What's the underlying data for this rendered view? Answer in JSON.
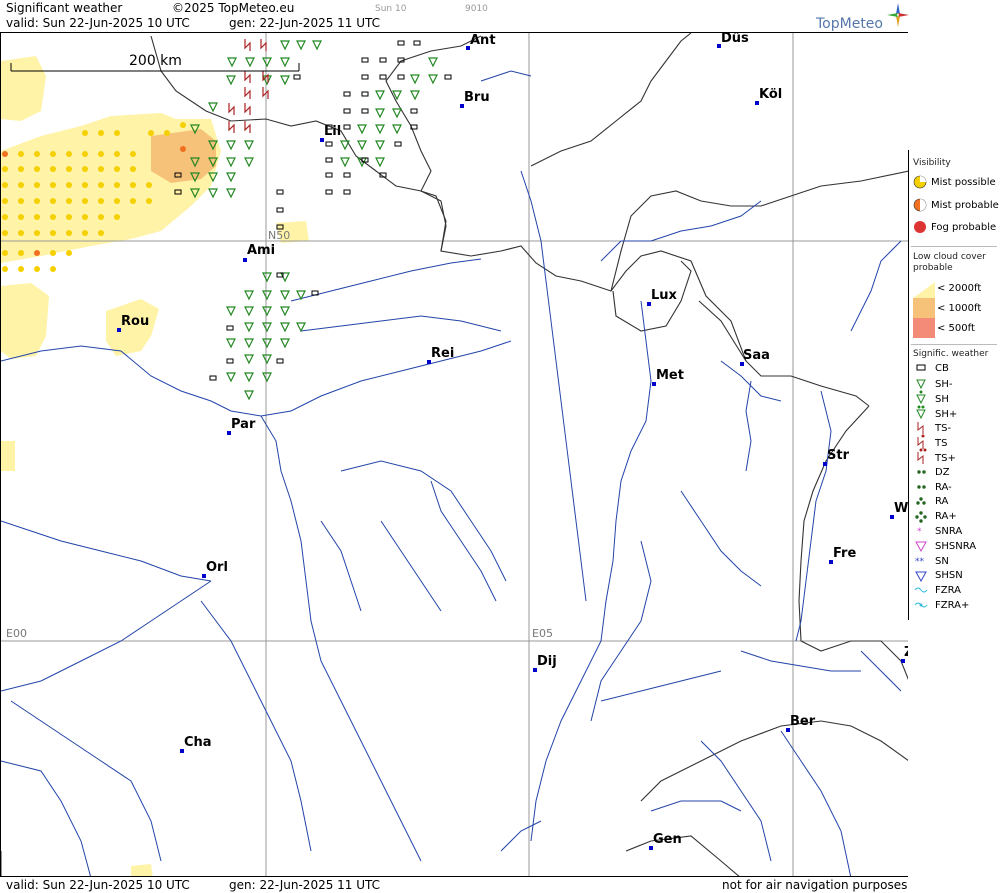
{
  "header": {
    "product": "Significant weather",
    "copyright": "©2025 TopMeteo.eu",
    "extra_small_1": "Sun 10",
    "extra_small_2": "9010",
    "valid": "valid:  Sun  22-Jun-2025  10 UTC",
    "generated": "gen: 22-Jun-2025 11 UTC",
    "logo": "TopMeteo"
  },
  "footer": {
    "valid": "valid:  Sun  22-Jun-2025  10 UTC",
    "generated": "gen: 22-Jun-2025 11 UTC",
    "disclaimer": "not for air navigation purposes"
  },
  "map": {
    "scale_label": "200 km",
    "grid_labels": {
      "n50": "N50",
      "e00": "E00",
      "e05": "E05"
    },
    "cities": [
      {
        "name": "Ant"
      },
      {
        "name": "Düs"
      },
      {
        "name": "Köl"
      },
      {
        "name": "Bru"
      },
      {
        "name": "Lil"
      },
      {
        "name": "Ami"
      },
      {
        "name": "Lux"
      },
      {
        "name": "Rou"
      },
      {
        "name": "Rei"
      },
      {
        "name": "Saa"
      },
      {
        "name": "Met"
      },
      {
        "name": "Par"
      },
      {
        "name": "Str"
      },
      {
        "name": "W"
      },
      {
        "name": "Fre"
      },
      {
        "name": "Orl"
      },
      {
        "name": "Dij"
      },
      {
        "name": "Z"
      },
      {
        "name": "Ber"
      },
      {
        "name": "Cha"
      },
      {
        "name": "Gen"
      }
    ],
    "colors": {
      "city_dot": "#0000cc",
      "river": "#2244aa",
      "border": "#333333",
      "grid": "#999999",
      "cloud_2000": "#fff3a8",
      "cloud_1000": "#f6c27a",
      "mist_possible": "#f5d000",
      "mist_probable": "#f07020",
      "shower_green": "#228822",
      "thunderstorm_red": "#aa2222"
    }
  },
  "legend": {
    "visibility": {
      "title": "Visibility",
      "items": [
        {
          "label": "Mist possible"
        },
        {
          "label": "Mist probable"
        },
        {
          "label": "Fog probable"
        }
      ]
    },
    "low_cloud": {
      "title_1": "Low cloud cover",
      "title_2": "probable",
      "items": [
        {
          "label": "< 2000ft"
        },
        {
          "label": "< 1000ft"
        },
        {
          "label": "<   500ft"
        }
      ]
    },
    "sigwx": {
      "title": "Signific. weather",
      "items": [
        {
          "label": "CB"
        },
        {
          "label": "SH-"
        },
        {
          "label": "SH"
        },
        {
          "label": "SH+"
        },
        {
          "label": "TS-"
        },
        {
          "label": "TS"
        },
        {
          "label": "TS+"
        },
        {
          "label": "DZ"
        },
        {
          "label": "RA-"
        },
        {
          "label": "RA"
        },
        {
          "label": "RA+"
        },
        {
          "label": "SNRA"
        },
        {
          "label": "SHSNRA"
        },
        {
          "label": "SN"
        },
        {
          "label": "SHSN"
        },
        {
          "label": "FZRA"
        },
        {
          "label": "FZRA+"
        }
      ]
    }
  }
}
